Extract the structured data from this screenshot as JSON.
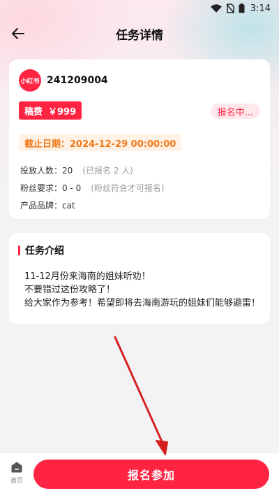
{
  "status_bar": {
    "time": "3:14"
  },
  "header": {
    "title": "任务详情"
  },
  "task": {
    "brand_logo_text": "小红书",
    "id": "241209004",
    "fee_label": "稿费",
    "fee_value": "￥999",
    "status": "报名中...",
    "deadline": "截止日期：2024-12-29 00:00:00",
    "rows": [
      {
        "label": "投放人数：",
        "value": "20",
        "note": "(已报名 2 人)"
      },
      {
        "label": "粉丝要求：",
        "value": "0 - 0",
        "note": "(粉丝符合才可报名)"
      },
      {
        "label": "产品品牌：",
        "value": "cat",
        "note": ""
      }
    ]
  },
  "description": {
    "title": "任务介绍",
    "lines": [
      "11-12月份来海南的姐妹听劝！",
      "不要错过这份攻略了！",
      "给大家作为参考！希望即将去海南游玩的姐妹们能够避雷！"
    ]
  },
  "bottom": {
    "home_label": "首页",
    "join_label": "报名参加"
  },
  "colors": {
    "accent": "#ff2442",
    "deadline": "#f07a1a",
    "annotation_arrow": "#d62020"
  }
}
